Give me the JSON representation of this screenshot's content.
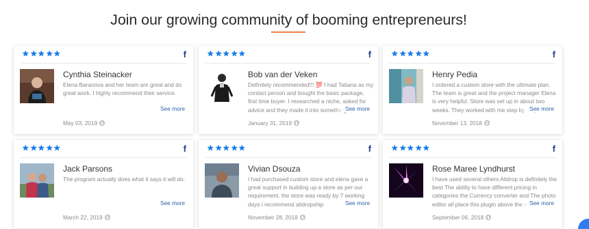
{
  "heading": "Join our growing community of booming entrepreneurs!",
  "colors": {
    "accent": "#ef7d4a",
    "star": "#1e7fe8",
    "facebook": "#1f3d8a",
    "link": "#2b5fa5"
  },
  "rating_stars": 5,
  "facebook_glyph": "f",
  "testimonials": [
    {
      "name": "Cynthia Steinacker",
      "review": "Elena Baranova and her team are great and do great work. I highly recommend their service.",
      "see_more": "See more",
      "date": "May 03, 2019"
    },
    {
      "name": "Bob van der Veken",
      "review": "Definitely recommended!!! 💯 I had Tatiana as my contact person and bought the basic package, first time buyer. I researched a niche, asked for advice and they made it into something...",
      "see_more": "See more",
      "date": "January 31, 2019"
    },
    {
      "name": "Henry Pedia",
      "review": "I ordered a custom store with the ultimate plan. The team is great and the project manager Elena is very helpful. Store was set up in about two weeks. They worked with me step by step...",
      "see_more": "See more",
      "date": "November 13, 2018"
    },
    {
      "name": "Jack Parsons",
      "review": "The program actually does what it says it will do.",
      "see_more": "See more",
      "date": "March 22, 2019"
    },
    {
      "name": "Vivian Dsouza",
      "review": "I had purchased custom store and elena gave a great support in building up a store as per our requirement. the store was ready by 7 working days i recommend alidropship",
      "see_more": "See more",
      "date": "November 28, 2018"
    },
    {
      "name": "Rose Maree Lyndhurst",
      "review": "I have used several others Alidrop is definitely the best The ability to have different pricing in categories the Currency converter and The photo editor all place this plugin above the rest...",
      "see_more": "See more",
      "date": "September 06, 2018"
    }
  ]
}
